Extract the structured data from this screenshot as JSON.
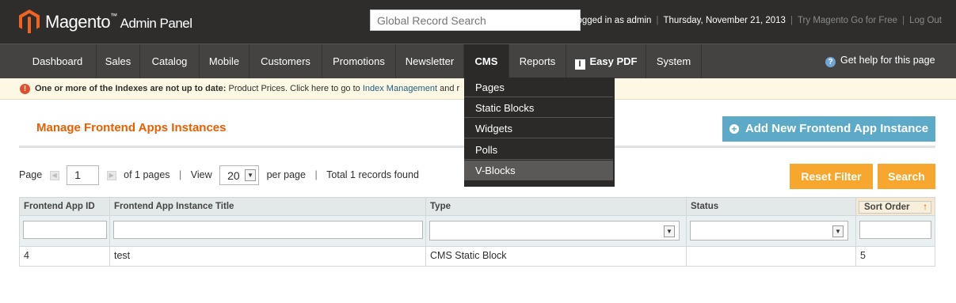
{
  "header": {
    "logo_name": "Magento",
    "logo_tm": "™",
    "logo_sub": "Admin Panel",
    "search_placeholder": "Global Record Search",
    "logged_in": "Logged in as admin",
    "date": "Thursday, November 21, 2013",
    "try_link": "Try Magento Go for Free",
    "logout": "Log Out",
    "separator": "|"
  },
  "nav": {
    "items": [
      "Dashboard",
      "Sales",
      "Catalog",
      "Mobile",
      "Customers",
      "Promotions",
      "Newsletter",
      "CMS",
      "Reports",
      "Easy PDF",
      "System"
    ],
    "active": "CMS",
    "pdf_glyph": "I",
    "help": "Get help for this page",
    "help_glyph": "?"
  },
  "cms_menu": {
    "items": [
      "Pages",
      "Static Blocks",
      "Widgets",
      "Polls",
      "V-Blocks"
    ],
    "highlighted": "V-Blocks"
  },
  "notice": {
    "icon": "!",
    "bold": "One or more of the Indexes are not up to date:",
    "text": "Product Prices. Click here to go to",
    "link": "Index Management",
    "tail": "and r"
  },
  "page": {
    "title": "Manage Frontend Apps Instances",
    "add_button": "Add New Frontend App Instance",
    "add_glyph": "+"
  },
  "pager": {
    "page_label": "Page",
    "page_value": "1",
    "of_pages": "of 1 pages",
    "sep": "|",
    "view_label": "View",
    "view_value": "20",
    "per_page": "per page",
    "total": "Total 1 records found",
    "reset_button": "Reset Filter",
    "search_button": "Search"
  },
  "grid": {
    "columns": [
      "Frontend App ID",
      "Frontend App Instance Title",
      "Type",
      "Status",
      "Sort Order"
    ],
    "sort_arrow": "↑",
    "rows": [
      {
        "id": "4",
        "title": "test",
        "type": "CMS Static Block",
        "status": "",
        "sort": "5"
      }
    ]
  },
  "colors": {
    "header_bg": "#2e2d2b",
    "nav_bg": "#444341",
    "title_orange": "#eb5e00",
    "add_button_blue": "#5da9c8",
    "action_orange": "#f7a72d"
  }
}
